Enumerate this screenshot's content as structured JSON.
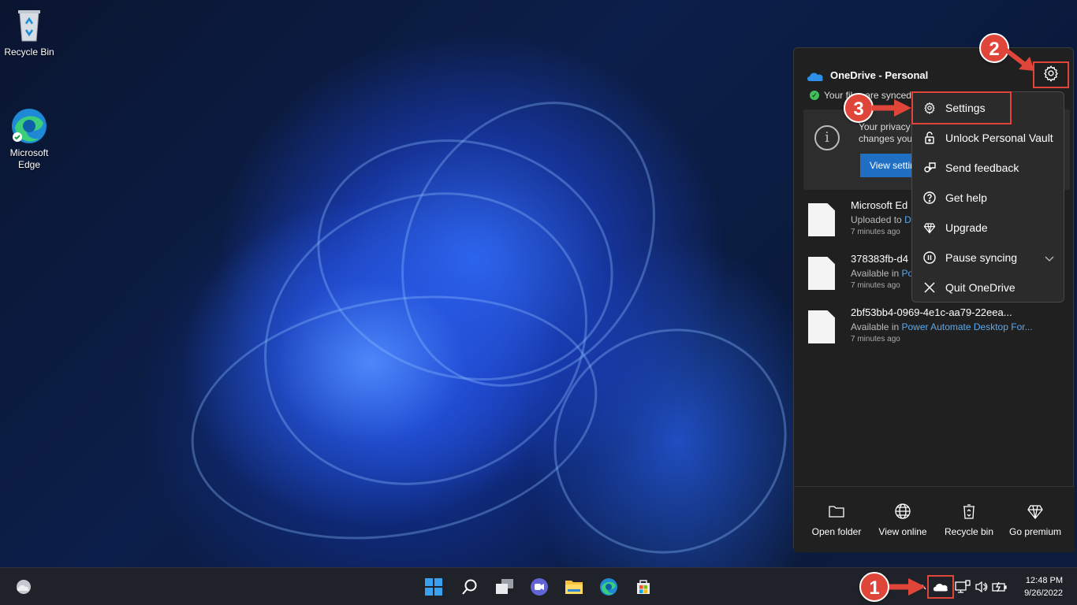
{
  "desktop": {
    "icons": [
      {
        "label": "Recycle Bin"
      },
      {
        "label": "Microsoft\nEdge"
      }
    ]
  },
  "onedrive": {
    "title": "OneDrive - Personal",
    "sync_status": "Your files are synced",
    "notice_text": "Your privacy\nchanges you",
    "notice_button": "View settings",
    "files": [
      {
        "name": "Microsoft Ed",
        "status_prefix": "Uploaded to",
        "location": "D",
        "time": "7 minutes ago"
      },
      {
        "name": "378383fb-d4",
        "status_prefix": "Available in",
        "location": "Pov",
        "time": "7 minutes ago"
      },
      {
        "name": "2bf53bb4-0969-4e1c-aa79-22eea...",
        "status_prefix": "Available in",
        "location": "Power Automate Desktop For...",
        "time": "7 minutes ago"
      }
    ],
    "footer": [
      {
        "label": "Open folder",
        "icon": "folder-icon"
      },
      {
        "label": "View online",
        "icon": "globe-icon"
      },
      {
        "label": "Recycle bin",
        "icon": "recycle-bin-icon"
      },
      {
        "label": "Go premium",
        "icon": "diamond-icon"
      }
    ]
  },
  "menu": {
    "items": [
      {
        "label": "Settings",
        "icon": "gear-icon"
      },
      {
        "label": "Unlock Personal Vault",
        "icon": "lock-icon"
      },
      {
        "label": "Send feedback",
        "icon": "feedback-icon"
      },
      {
        "label": "Get help",
        "icon": "help-icon"
      },
      {
        "label": "Upgrade",
        "icon": "diamond-icon"
      },
      {
        "label": "Pause syncing",
        "icon": "pause-icon"
      },
      {
        "label": "Quit OneDrive",
        "icon": "close-icon"
      }
    ]
  },
  "annotations": [
    "1",
    "2",
    "3"
  ],
  "taskbar": {
    "time": "12:48 PM",
    "date": "9/26/2022"
  },
  "colors": {
    "accent_red": "#e0453a",
    "link_blue": "#5aa8ee",
    "button_blue": "#1f6fc5"
  }
}
